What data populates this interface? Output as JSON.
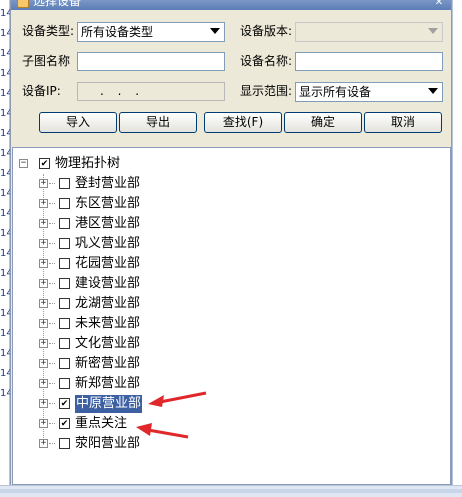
{
  "window": {
    "title": "选择设备",
    "close_glyph": "✕"
  },
  "background": {
    "left_row_numbers": [
      "14",
      "14",
      "14",
      "14",
      "14",
      "14",
      "14",
      "14",
      "14",
      "14",
      "14",
      "14",
      "14",
      "14",
      "14",
      "14",
      "14",
      "14",
      "14",
      "14"
    ]
  },
  "form": {
    "device_type_label": "设备类型:",
    "device_type_value": "所有设备类型",
    "device_version_label": "设备版本:",
    "device_version_value": "",
    "subgraph_name_label": "子图名称",
    "subgraph_name_value": "",
    "device_name_label": "设备名称:",
    "device_name_value": "",
    "device_ip_label": "设备IP:",
    "device_ip_value": ". . .",
    "display_range_label": "显示范围:",
    "display_range_value": "显示所有设备"
  },
  "buttons": {
    "import": "导入",
    "export": "导出",
    "find": "查找(F)",
    "ok": "确定",
    "cancel": "取消"
  },
  "tree": {
    "root": {
      "label": "物理拓扑树",
      "checked": true,
      "expander": "−"
    },
    "items": [
      {
        "label": "登封营业部",
        "checked": false,
        "expander": "+"
      },
      {
        "label": "东区营业部",
        "checked": false,
        "expander": "+"
      },
      {
        "label": "港区营业部",
        "checked": false,
        "expander": "+"
      },
      {
        "label": "巩义营业部",
        "checked": false,
        "expander": "+"
      },
      {
        "label": "花园营业部",
        "checked": false,
        "expander": "+"
      },
      {
        "label": "建设营业部",
        "checked": false,
        "expander": "+"
      },
      {
        "label": "龙湖营业部",
        "checked": false,
        "expander": "+"
      },
      {
        "label": "未来营业部",
        "checked": false,
        "expander": "+"
      },
      {
        "label": "文化营业部",
        "checked": false,
        "expander": "+"
      },
      {
        "label": "新密营业部",
        "checked": false,
        "expander": "+"
      },
      {
        "label": "新郑营业部",
        "checked": false,
        "expander": "+"
      },
      {
        "label": "中原营业部",
        "checked": true,
        "expander": "+",
        "selected": true
      },
      {
        "label": "重点关注",
        "checked": true,
        "expander": "+"
      },
      {
        "label": "荥阳营业部",
        "checked": false,
        "expander": "+"
      }
    ]
  },
  "colors": {
    "selection": "#3c60a2",
    "annotation_arrow": "#e0282a",
    "dialog_bg": "#ece9d8"
  }
}
